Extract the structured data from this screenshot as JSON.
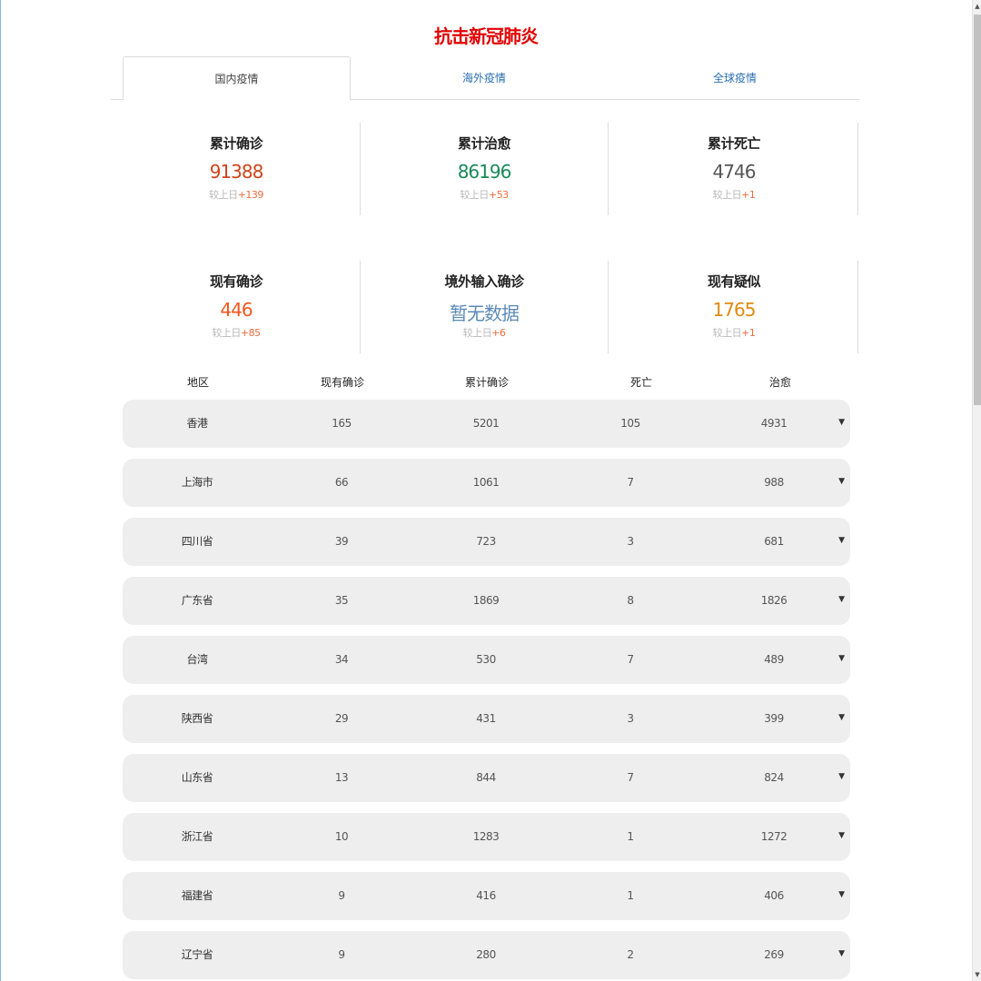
{
  "title": "抗击新冠肺炎",
  "tabs": [
    {
      "label": "国内疫情"
    },
    {
      "label": "海外疫情"
    },
    {
      "label": "全球疫情"
    }
  ],
  "stats": [
    {
      "label": "累计确诊",
      "value": "91388",
      "diff_prefix": "较上日",
      "diff": "+139",
      "color": "#d0441a"
    },
    {
      "label": "累计治愈",
      "value": "86196",
      "diff_prefix": "较上日",
      "diff": "+53",
      "color": "#1a8a5a"
    },
    {
      "label": "累计死亡",
      "value": "4746",
      "diff_prefix": "较上日",
      "diff": "+1",
      "color": "#555555"
    },
    {
      "label": "现有确诊",
      "value": "446",
      "diff_prefix": "较上日",
      "diff": "+85",
      "color": "#f0571e"
    },
    {
      "label": "境外输入确诊",
      "value": "暂无数据",
      "diff_prefix": "较上日",
      "diff": "+6",
      "color": "#5b8ab5"
    },
    {
      "label": "现有疑似",
      "value": "1765",
      "diff_prefix": "较上日",
      "diff": "+1",
      "color": "#e08a12"
    }
  ],
  "table": {
    "headers": [
      "地区",
      "现有确诊",
      "累计确诊",
      "死亡",
      "治愈"
    ],
    "rows": [
      [
        "香港",
        "165",
        "5201",
        "105",
        "4931"
      ],
      [
        "上海市",
        "66",
        "1061",
        "7",
        "988"
      ],
      [
        "四川省",
        "39",
        "723",
        "3",
        "681"
      ],
      [
        "广东省",
        "35",
        "1869",
        "8",
        "1826"
      ],
      [
        "台湾",
        "34",
        "530",
        "7",
        "489"
      ],
      [
        "陕西省",
        "29",
        "431",
        "3",
        "399"
      ],
      [
        "山东省",
        "13",
        "844",
        "7",
        "824"
      ],
      [
        "浙江省",
        "10",
        "1283",
        "1",
        "1272"
      ],
      [
        "福建省",
        "9",
        "416",
        "1",
        "406"
      ],
      [
        "辽宁省",
        "9",
        "280",
        "2",
        "269"
      ]
    ],
    "expand_icon": "▼"
  },
  "scrollbar": {
    "up_icon": "▲",
    "down_icon": "▼"
  }
}
